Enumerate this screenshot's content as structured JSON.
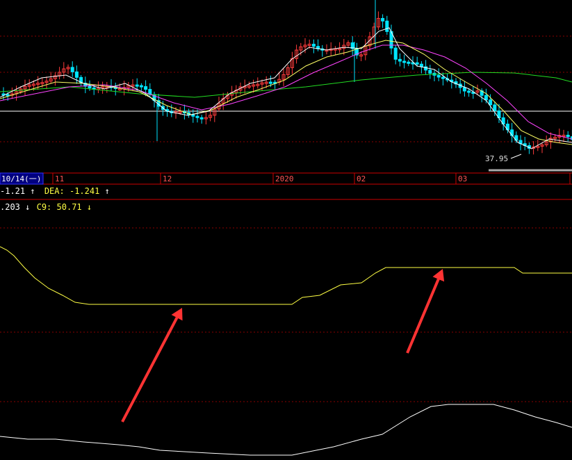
{
  "axis": {
    "date_box": "10/14(一)",
    "month_labels": [
      "11",
      "12",
      "2020",
      "02",
      "03"
    ]
  },
  "price": {
    "low_label": "37.95",
    "colors": {
      "up": "#ff3b3b",
      "down": "#00e5ff",
      "ma5": "#ffffff",
      "ma10": "#ffff66",
      "ma20": "#ff44ff",
      "ma60": "#22dd22"
    }
  },
  "macd": {
    "text_dif": "-1.21",
    "text_dea_label": "DEA:",
    "text_dea": "-1.241",
    "arrow_up": "↑"
  },
  "indicator": {
    "text_a": ".203",
    "text_c9_label": "C9:",
    "text_c9": "50.71",
    "arrow_down": "↓",
    "colors": {
      "yellow": "#ffff44",
      "white": "#ffffff",
      "arrow": "#ff3333"
    }
  }
}
